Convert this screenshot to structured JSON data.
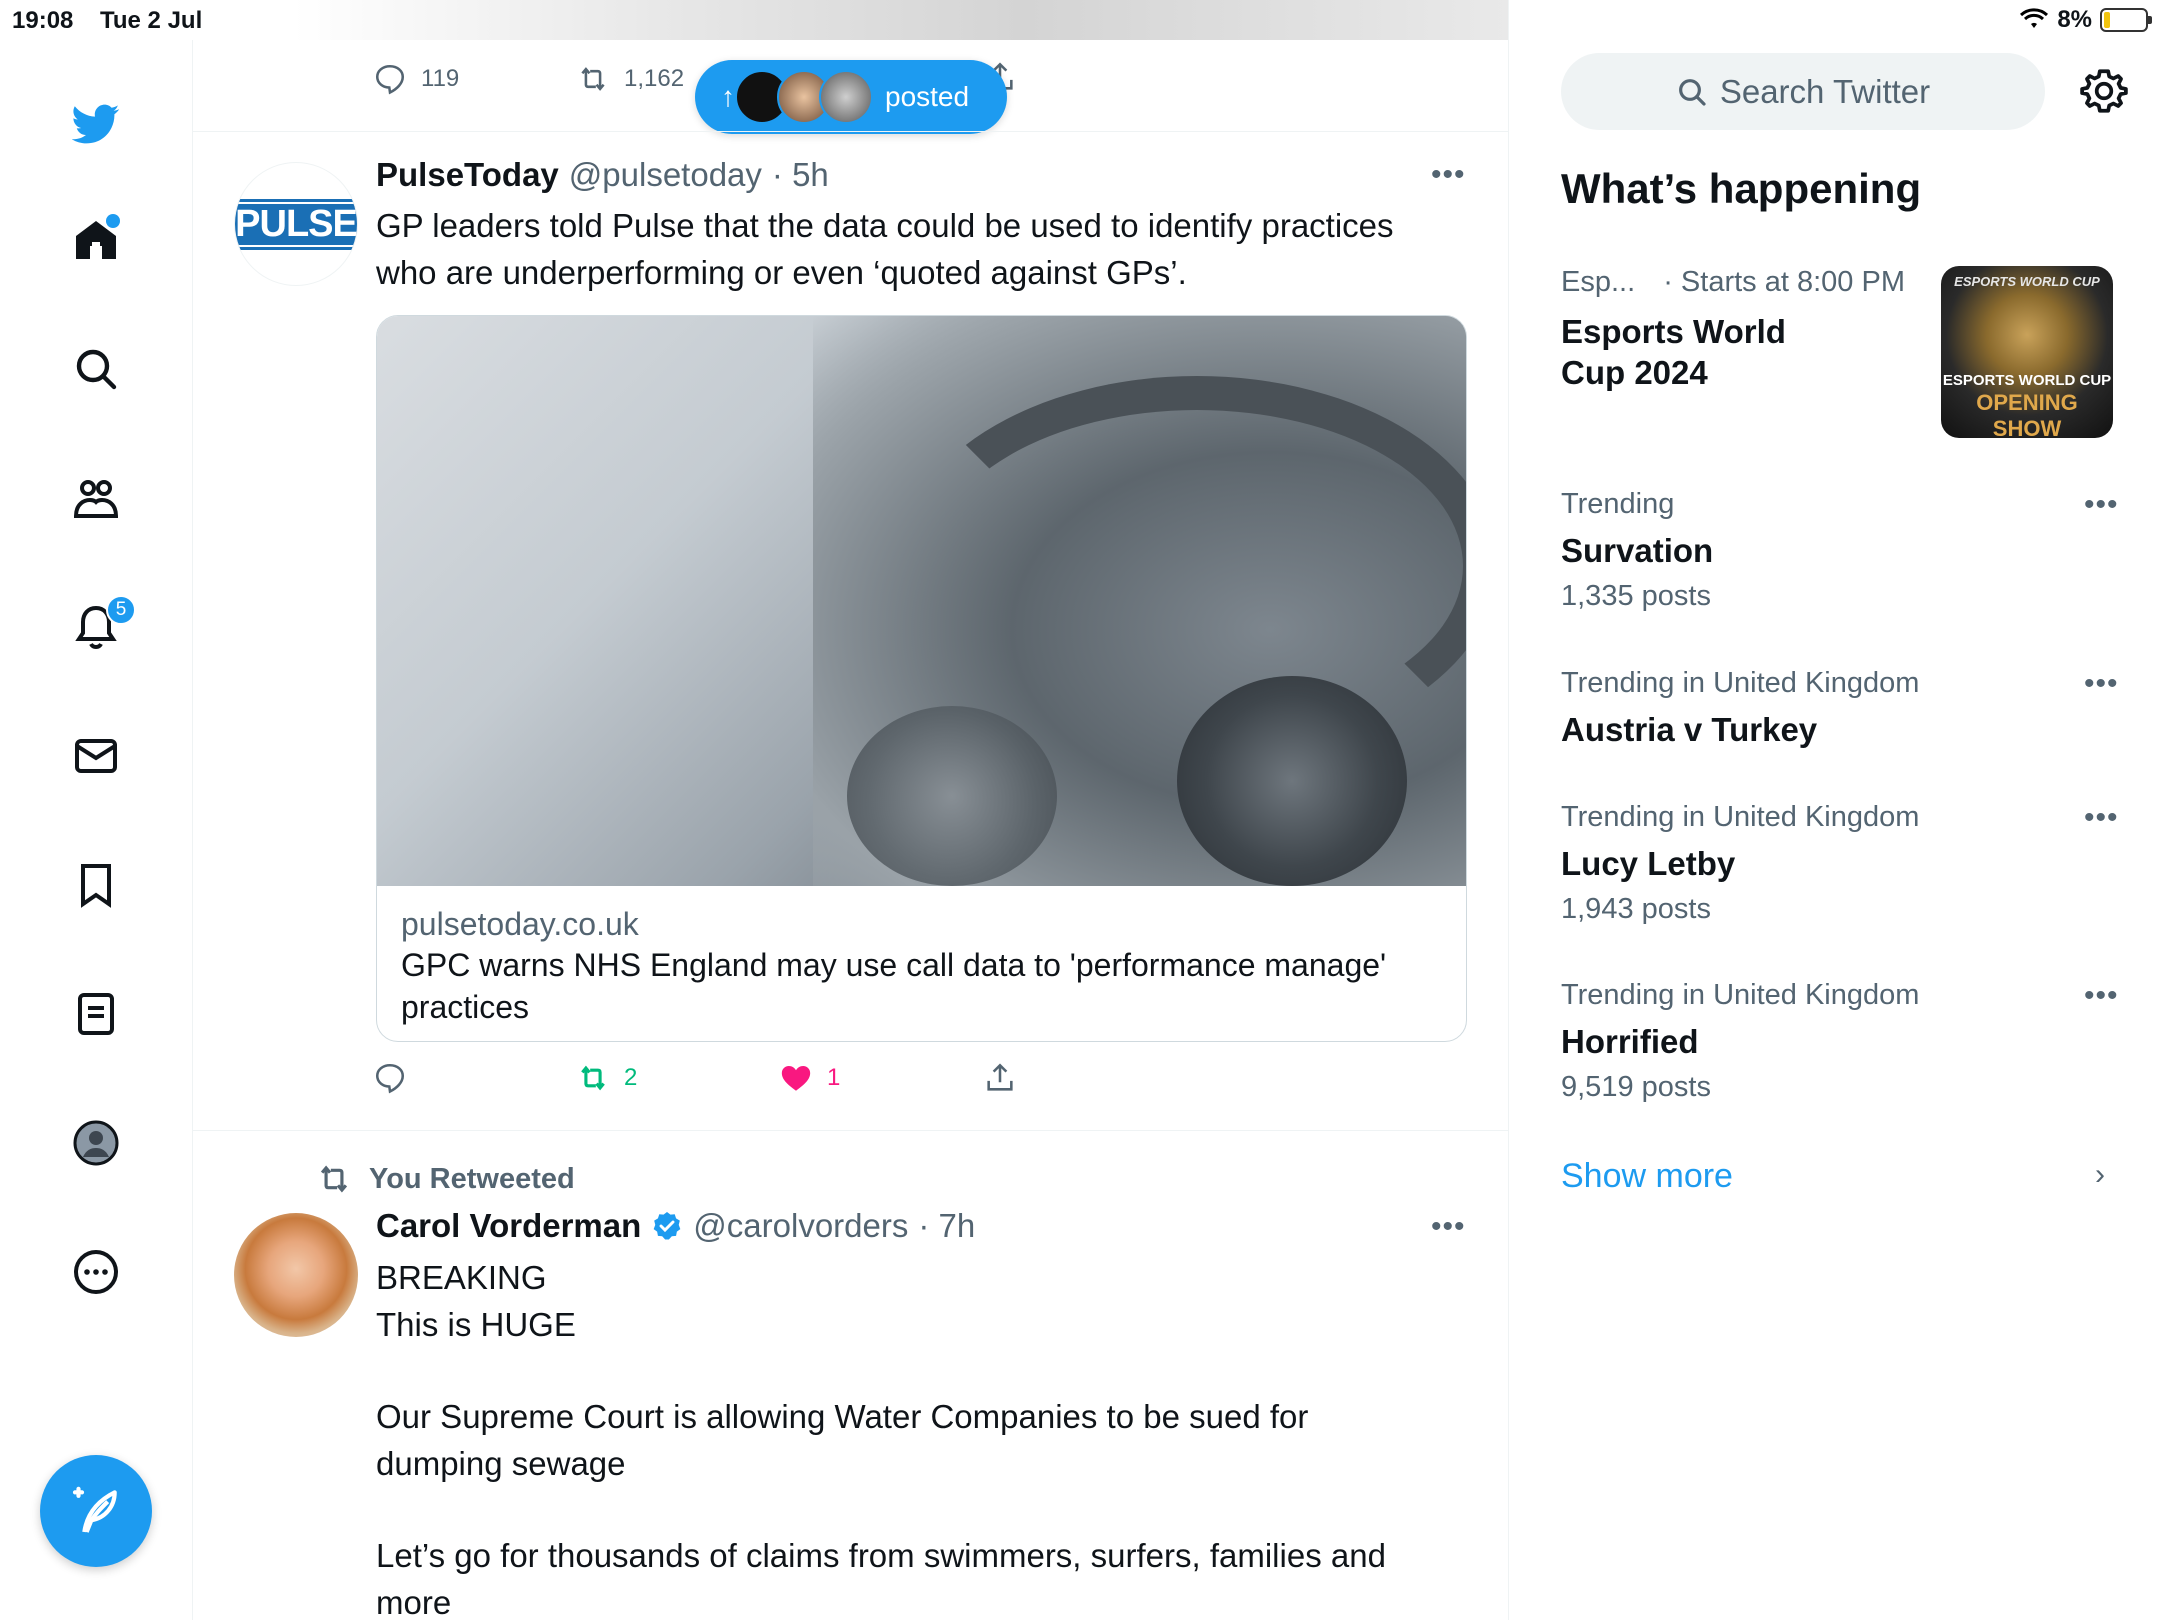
{
  "status_bar": {
    "time": "19:08",
    "date": "Tue 2 Jul",
    "battery": "8%"
  },
  "nav": {
    "notification_count": "5"
  },
  "new_posts_pill": {
    "label": "posted"
  },
  "prev_tweet": {
    "replies": "119",
    "retweets": "1,162"
  },
  "tweet1": {
    "name": "PulseToday",
    "handle": "@pulsetoday",
    "time": "5h",
    "text_line1": "GP leaders told Pulse that the data could be used to identify practices",
    "text_line2": "who are underperforming or even ‘quoted against GPs’.",
    "avatar_text": "PULSE",
    "card": {
      "domain": "pulsetoday.co.uk",
      "title": "GPC warns NHS England may use call data to 'performance manage' practices"
    },
    "retweets": "2",
    "likes": "1"
  },
  "tweet2": {
    "retweet_label": "You Retweeted",
    "name": "Carol Vorderman",
    "handle": "@carolvorders",
    "time": "7h",
    "lines": [
      "BREAKING",
      "This is HUGE",
      "",
      "Our Supreme Court is allowing Water Companies to be sued for",
      "dumping sewage",
      "",
      "Let’s go for thousands of claims from swimmers, surfers, families and",
      "more"
    ]
  },
  "sidebar": {
    "search_placeholder": "Search Twitter",
    "title": "What’s happening",
    "event": {
      "category": "Esp...",
      "time": "· Starts at 8:00 PM",
      "name_line1": "Esports World",
      "name_line2": "Cup 2024",
      "image_text_top": "ESPORTS WORLD CUP",
      "image_text_mid": "ESPORTS WORLD CUP",
      "image_text_bottom": "OPENING SHOW"
    },
    "trends": [
      {
        "meta": "Trending",
        "name": "Survation",
        "posts": "1,335 posts"
      },
      {
        "meta": "Trending in United Kingdom",
        "name": "Austria v Turkey",
        "posts": ""
      },
      {
        "meta": "Trending in United Kingdom",
        "name": "Lucy Letby",
        "posts": "1,943 posts"
      },
      {
        "meta": "Trending in United Kingdom",
        "name": "Horrified",
        "posts": "9,519 posts"
      }
    ],
    "show_more": "Show more"
  },
  "colors": {
    "brand": "#1d9bf0",
    "retweet_green": "#00ba7c",
    "like_pink": "#f91880",
    "secondary_text": "#536471"
  }
}
